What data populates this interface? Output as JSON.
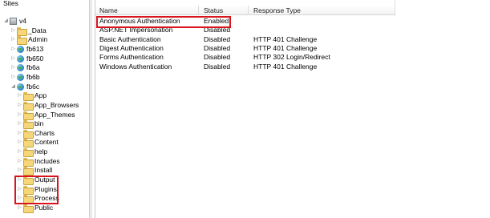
{
  "tree": {
    "root_label": "Sites",
    "items": [
      {
        "label": "v4",
        "icon": "server-icon",
        "expander": "◢",
        "level": 0
      },
      {
        "label": "_Data",
        "icon": "folder-icon",
        "expander": "▷",
        "level": 1
      },
      {
        "label": "Admin",
        "icon": "folder-icon",
        "expander": "▷",
        "level": 1
      },
      {
        "label": "fb613",
        "icon": "globe-icon",
        "expander": "▷",
        "level": 1
      },
      {
        "label": "fb650",
        "icon": "globe-icon",
        "expander": "▷",
        "level": 1
      },
      {
        "label": "fb6a",
        "icon": "globe-icon",
        "expander": "▷",
        "level": 1
      },
      {
        "label": "fb6b",
        "icon": "globe-icon",
        "expander": "▷",
        "level": 1
      },
      {
        "label": "fb6c",
        "icon": "globe-icon",
        "expander": "◢",
        "level": 1
      },
      {
        "label": "App",
        "icon": "folder-icon",
        "expander": "▷",
        "level": 2
      },
      {
        "label": "App_Browsers",
        "icon": "folder-icon",
        "expander": "▷",
        "level": 2
      },
      {
        "label": "App_Themes",
        "icon": "folder-icon",
        "expander": "▷",
        "level": 2
      },
      {
        "label": "bin",
        "icon": "folder-icon",
        "expander": "▷",
        "level": 2
      },
      {
        "label": "Charts",
        "icon": "folder-icon",
        "expander": "▷",
        "level": 2
      },
      {
        "label": "Content",
        "icon": "folder-icon",
        "expander": "▷",
        "level": 2
      },
      {
        "label": "help",
        "icon": "folder-icon",
        "expander": "▷",
        "level": 2
      },
      {
        "label": "Includes",
        "icon": "folder-icon",
        "expander": "▷",
        "level": 2
      },
      {
        "label": "Install",
        "icon": "folder-icon",
        "expander": "▷",
        "level": 2
      },
      {
        "label": "Output",
        "icon": "folder-icon",
        "expander": "▷",
        "level": 2
      },
      {
        "label": "Plugins",
        "icon": "folder-icon",
        "expander": "▷",
        "level": 2
      },
      {
        "label": "Process",
        "icon": "folder-icon",
        "expander": "▷",
        "level": 2
      },
      {
        "label": "Public",
        "icon": "folder-icon",
        "expander": "▷",
        "level": 2
      }
    ]
  },
  "list": {
    "columns": [
      "Name",
      "Status",
      "Response Type"
    ],
    "rows": [
      {
        "name": "Anonymous Authentication",
        "status": "Enabled",
        "response": ""
      },
      {
        "name": "ASP.NET Impersonation",
        "status": "Disabled",
        "response": ""
      },
      {
        "name": "Basic Authentication",
        "status": "Disabled",
        "response": "HTTP 401 Challenge"
      },
      {
        "name": "Digest Authentication",
        "status": "Disabled",
        "response": "HTTP 401 Challenge"
      },
      {
        "name": "Forms Authentication",
        "status": "Disabled",
        "response": "HTTP 302 Login/Redirect"
      },
      {
        "name": "Windows Authentication",
        "status": "Disabled",
        "response": "HTTP 401 Challenge"
      }
    ]
  },
  "colors": {
    "highlight": "#d8151d",
    "folder": "#f5d77a"
  }
}
